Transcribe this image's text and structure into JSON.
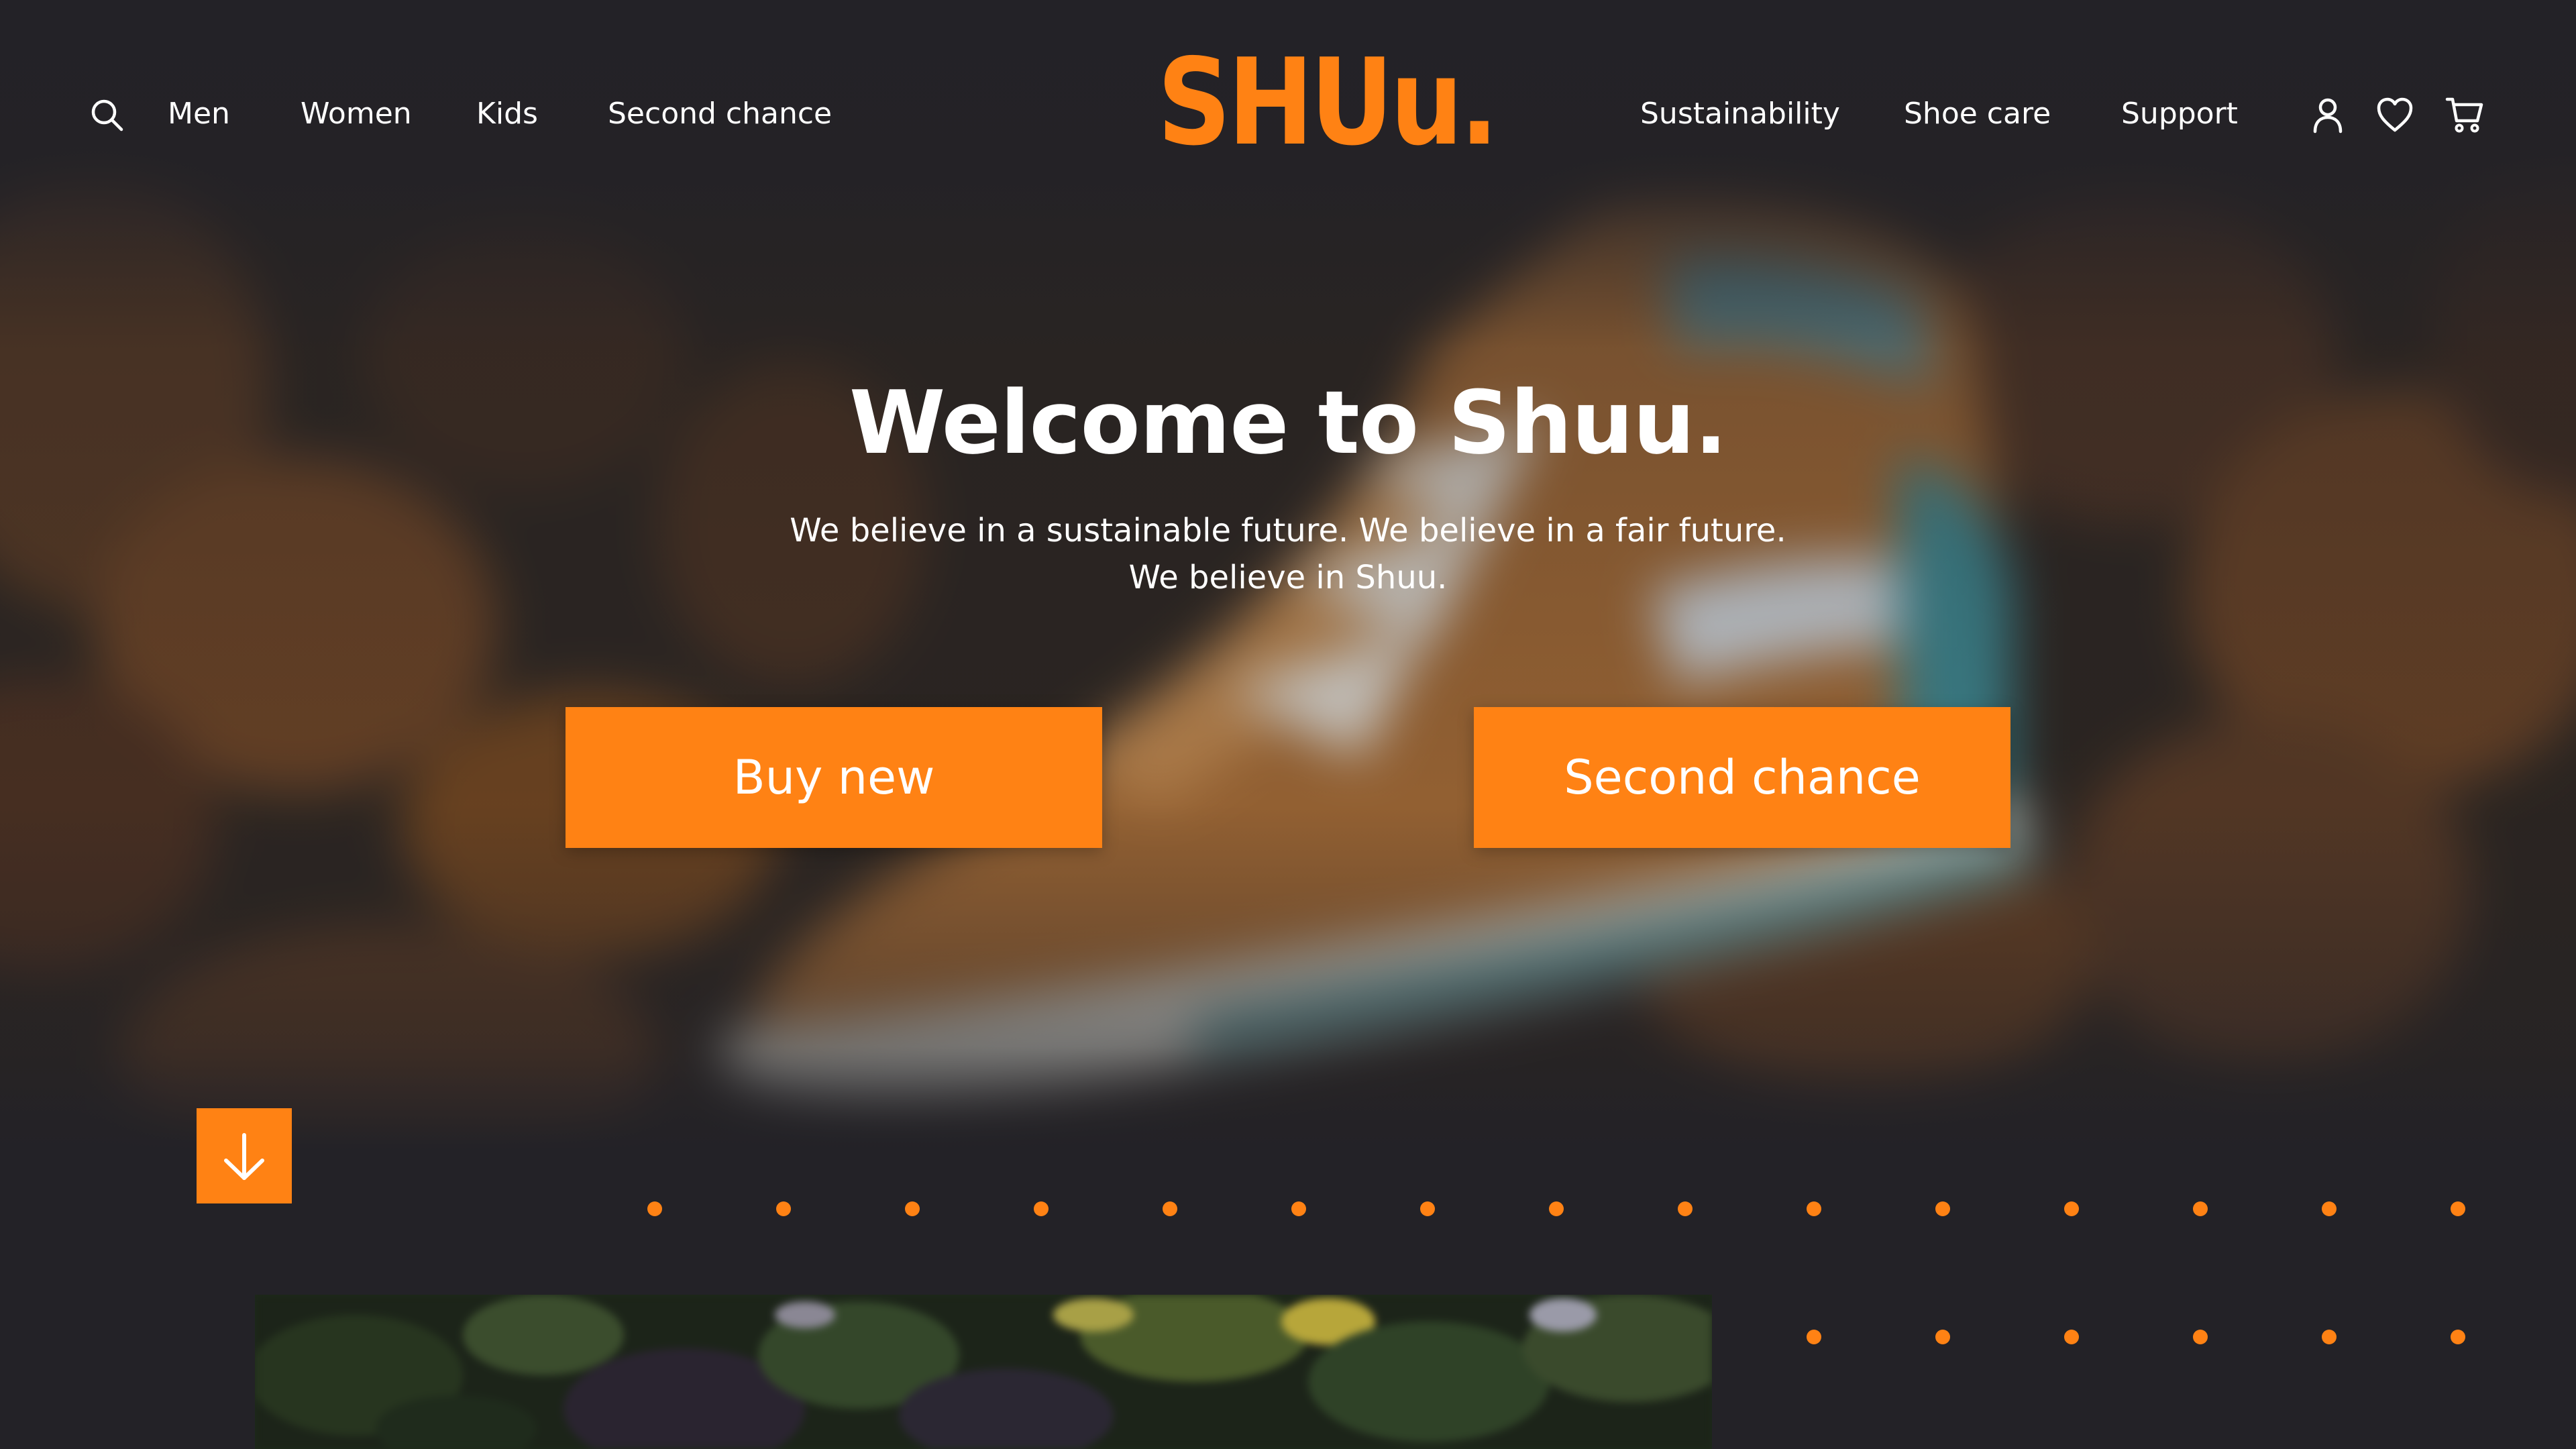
{
  "brand": {
    "logo_text": "SHUu.",
    "accent_color": "#ff8214",
    "background_color": "#232227"
  },
  "nav": {
    "left": [
      {
        "label": "Men"
      },
      {
        "label": "Women"
      },
      {
        "label": "Kids"
      },
      {
        "label": "Second chance"
      }
    ],
    "right": [
      {
        "label": "Sustainability"
      },
      {
        "label": "Shoe care"
      },
      {
        "label": "Support"
      }
    ],
    "icons": [
      "search-icon",
      "user-icon",
      "heart-icon",
      "cart-icon"
    ]
  },
  "hero": {
    "title": "Welcome to Shuu.",
    "subtitle_line1": "We believe in a sustainable future. We believe in a fair future.",
    "subtitle_line2": "We believe in Shuu.",
    "buttons": {
      "buy_new": "Buy new",
      "second_chance": "Second chance"
    },
    "scroll_icon": "arrow-down-icon"
  }
}
